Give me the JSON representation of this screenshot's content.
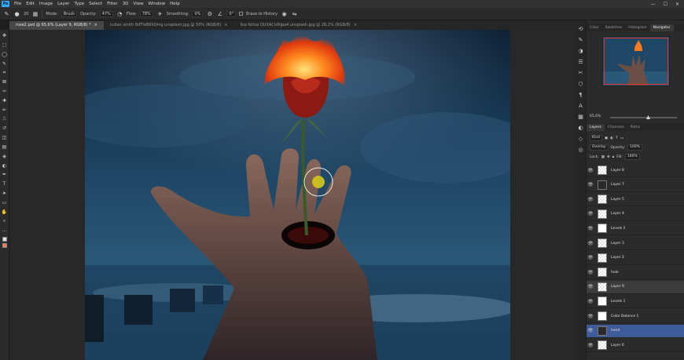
{
  "menubar": {
    "logo": "Ps",
    "items": [
      "File",
      "Edit",
      "Image",
      "Layer",
      "Type",
      "Select",
      "Filter",
      "3D",
      "View",
      "Window",
      "Help"
    ],
    "window_controls": [
      "—",
      "☐",
      "✕"
    ]
  },
  "options_bar": {
    "brush_size": "20",
    "mode_label": "Mode:",
    "mode_value": "Brush",
    "opacity_label": "Opacity:",
    "opacity_value": "47%",
    "flow_label": "Flow:",
    "flow_value": "78%",
    "smoothing_label": "Smoothing:",
    "smoothing_value": "0%",
    "angle_value": "0°",
    "erase_history_label": "Erase to History"
  },
  "tabs": [
    {
      "label": "rose2.psd @ 65,6% (Layer 9, RGB/8) *",
      "active": true
    },
    {
      "label": "cullan smith 8dTfeBIlhOmg unsplash.jpg @ 50% (RGB/8)",
      "active": false
    },
    {
      "label": "lisa fotios DUXACn0ljpa4 unsplash.jpg @ 28,2% (RGB/8)",
      "active": false
    }
  ],
  "toolbar": {
    "tools": [
      "move-tool",
      "marquee-tool",
      "lasso-tool",
      "quick-select-tool",
      "crop-tool",
      "frame-tool",
      "eyedropper-tool",
      "healing-tool",
      "brush-tool",
      "clone-stamp-tool",
      "history-brush-tool",
      "eraser-tool",
      "gradient-tool",
      "blur-tool",
      "dodge-tool",
      "pen-tool",
      "type-tool",
      "path-select-tool",
      "rectangle-tool",
      "hand-tool",
      "zoom-tool",
      "more-tools"
    ],
    "glyphs": [
      "✥",
      "⬚",
      "◯",
      "✎",
      "⌗",
      "⊠",
      "✑",
      "✚",
      "✏",
      "⎍",
      "↺",
      "◫",
      "▤",
      "◈",
      "◐",
      "✒",
      "T",
      "➤",
      "▭",
      "✋",
      "⌕",
      "…"
    ]
  },
  "navigator": {
    "tabs": [
      "Color",
      "Swatches",
      "Histogram",
      "Navigator"
    ],
    "active_tab": "Navigator",
    "zoom": "65,6%"
  },
  "layers": {
    "tabs": [
      "Layers",
      "Channels",
      "Paths"
    ],
    "active_tab": "Layers",
    "filter_label": "Kind",
    "blend_mode": "Overlay",
    "opacity_label": "Opacity:",
    "opacity_value": "100%",
    "lock_label": "Lock:",
    "fill_label": "Fill:",
    "fill_value": "100%",
    "rows": [
      {
        "name": "Layer 8",
        "thumb": "checker",
        "state": ""
      },
      {
        "name": "Layer 7",
        "thumb": "dark",
        "state": ""
      },
      {
        "name": "Layer 5",
        "thumb": "checker",
        "state": ""
      },
      {
        "name": "Layer 4",
        "thumb": "checker",
        "state": ""
      },
      {
        "name": "Levels 2",
        "thumb": "white",
        "state": ""
      },
      {
        "name": "Layer 3",
        "thumb": "checker",
        "state": ""
      },
      {
        "name": "Layer 2",
        "thumb": "checker",
        "state": ""
      },
      {
        "name": "hole",
        "thumb": "checker",
        "state": ""
      },
      {
        "name": "Layer 9",
        "thumb": "checker",
        "state": "hl"
      },
      {
        "name": "Levels 1",
        "thumb": "white",
        "state": ""
      },
      {
        "name": "Color Balance 1",
        "thumb": "white",
        "state": ""
      },
      {
        "name": "hand",
        "thumb": "dark",
        "state": "sel"
      },
      {
        "name": "Layer 6",
        "thumb": "checker",
        "state": ""
      }
    ]
  },
  "colors": {
    "accent": "#31a8ff",
    "selected_layer": "#3d5a99",
    "foreground_swatch": "#e2e2e2",
    "background_swatch": "#f07a5a",
    "navigator_frame": "#e0302a"
  }
}
